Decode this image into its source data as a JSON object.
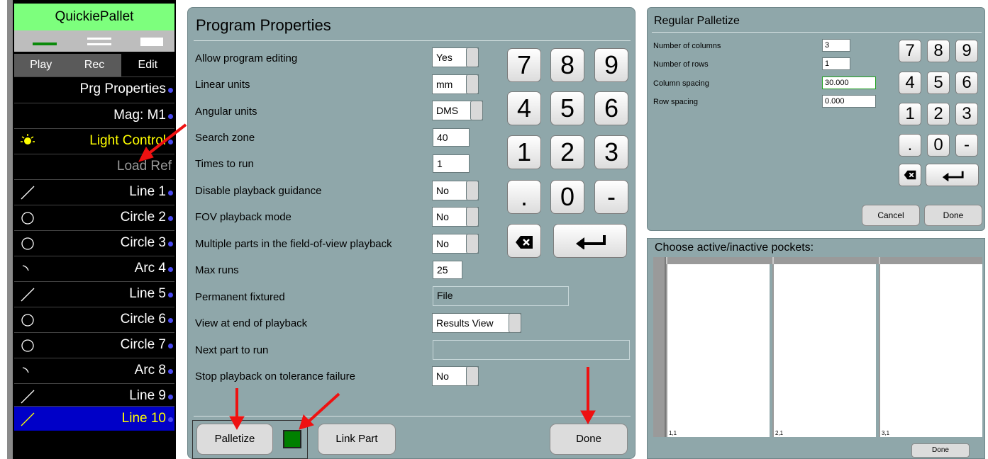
{
  "left_panel": {
    "app_title": "QuickiePallet",
    "tabs": [
      {
        "label": "Play"
      },
      {
        "label": "Rec"
      },
      {
        "label": "Edit"
      }
    ],
    "items": [
      {
        "label": "Prg Properties",
        "icon": "none"
      },
      {
        "label": "Mag: M1",
        "icon": "none"
      },
      {
        "label": "Light Control",
        "icon": "bulb-icon"
      },
      {
        "label": "Load Ref",
        "icon": "none"
      },
      {
        "label": "Line 1",
        "icon": "line-icon"
      },
      {
        "label": "Circle 2",
        "icon": "circle-icon"
      },
      {
        "label": "Circle 3",
        "icon": "circle-icon"
      },
      {
        "label": "Arc 4",
        "icon": "arc-icon"
      },
      {
        "label": "Line 5",
        "icon": "line-icon"
      },
      {
        "label": "Circle 6",
        "icon": "circle-icon"
      },
      {
        "label": "Circle 7",
        "icon": "circle-icon"
      },
      {
        "label": "Arc 8",
        "icon": "arc-icon"
      },
      {
        "label": "Line 9",
        "icon": "line-icon"
      },
      {
        "label": "Line 10",
        "icon": "line-icon"
      }
    ],
    "colors": {
      "title_bg": "#7dff7d",
      "selected_bg": "#0000c8",
      "selected_text": "#ffff00",
      "dot": "#4a4af0"
    }
  },
  "program_properties": {
    "title": "Program Properties",
    "rows": [
      {
        "label": "Allow program editing",
        "value": "Yes"
      },
      {
        "label": "Linear units",
        "value": "mm"
      },
      {
        "label": "Angular units",
        "value": "DMS"
      },
      {
        "label": "Search zone",
        "value": "40"
      },
      {
        "label": "Times to run",
        "value": "1"
      },
      {
        "label": "Disable playback guidance",
        "value": "No"
      },
      {
        "label": "FOV playback mode",
        "value": "No"
      },
      {
        "label": "Multiple parts in the field-of-view playback",
        "value": "No"
      },
      {
        "label": "Max runs",
        "value": "25"
      },
      {
        "label": "Permanent fixtured",
        "value": "File"
      },
      {
        "label": "View at end of playback",
        "value": "Results View"
      },
      {
        "label": "Next part to run",
        "value": ""
      },
      {
        "label": "Stop playback on tolerance failure",
        "value": "No"
      }
    ],
    "keypad": [
      "7",
      "8",
      "9",
      "4",
      "5",
      "6",
      "1",
      "2",
      "3",
      ".",
      "0",
      "-"
    ],
    "buttons": {
      "palletize": "Palletize",
      "link_part": "Link Part",
      "done": "Done"
    },
    "colors": {
      "panel_bg": "#8fa7aa",
      "indicator": "#008000"
    }
  },
  "regular_palletize": {
    "title": "Regular Palletize",
    "rows": [
      {
        "label": "Number of columns",
        "value": "3"
      },
      {
        "label": "Number of rows",
        "value": "1"
      },
      {
        "label": "Column spacing",
        "value": "30.000"
      },
      {
        "label": "Row spacing",
        "value": "0.000"
      }
    ],
    "keypad": [
      "7",
      "8",
      "9",
      "4",
      "5",
      "6",
      "1",
      "2",
      "3",
      ".",
      "0",
      "-"
    ],
    "buttons": {
      "cancel": "Cancel",
      "done": "Done"
    }
  },
  "choose_pockets": {
    "title": "Choose active/inactive pockets:",
    "pockets": [
      {
        "label": "1,1"
      },
      {
        "label": "2,1"
      },
      {
        "label": "3,1"
      }
    ],
    "done_label": "Done"
  },
  "annotations": {
    "arrow_color": "#ee1111"
  }
}
